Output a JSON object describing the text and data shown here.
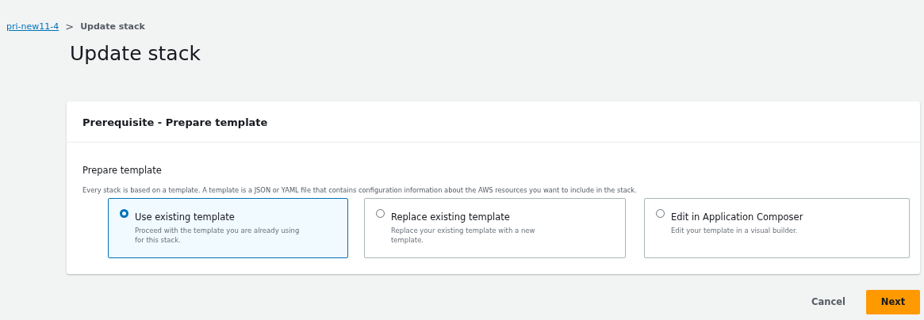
{
  "breadcrumb": {
    "link": "pri-new11-4",
    "separator": ">",
    "current": "Update stack"
  },
  "title": "Update stack",
  "panel": {
    "title": "Prerequisite - Prepare template",
    "field_label": "Prepare template",
    "description": "Every stack is based on a template. A template is a JSON or YAML file that contains configuration information about the AWS resources you want to include in the stack.",
    "options": [
      {
        "label": "Use existing template",
        "description": "Proceed with the template you are already using for this stack.",
        "selected": true
      },
      {
        "label": "Replace existing template",
        "description": "Replace your existing template with a new template.",
        "selected": false
      },
      {
        "label": "Edit in Application Composer",
        "description": "Edit your template in a visual builder.",
        "selected": false
      }
    ]
  },
  "buttons": {
    "cancel": "Cancel",
    "next": "Next"
  }
}
